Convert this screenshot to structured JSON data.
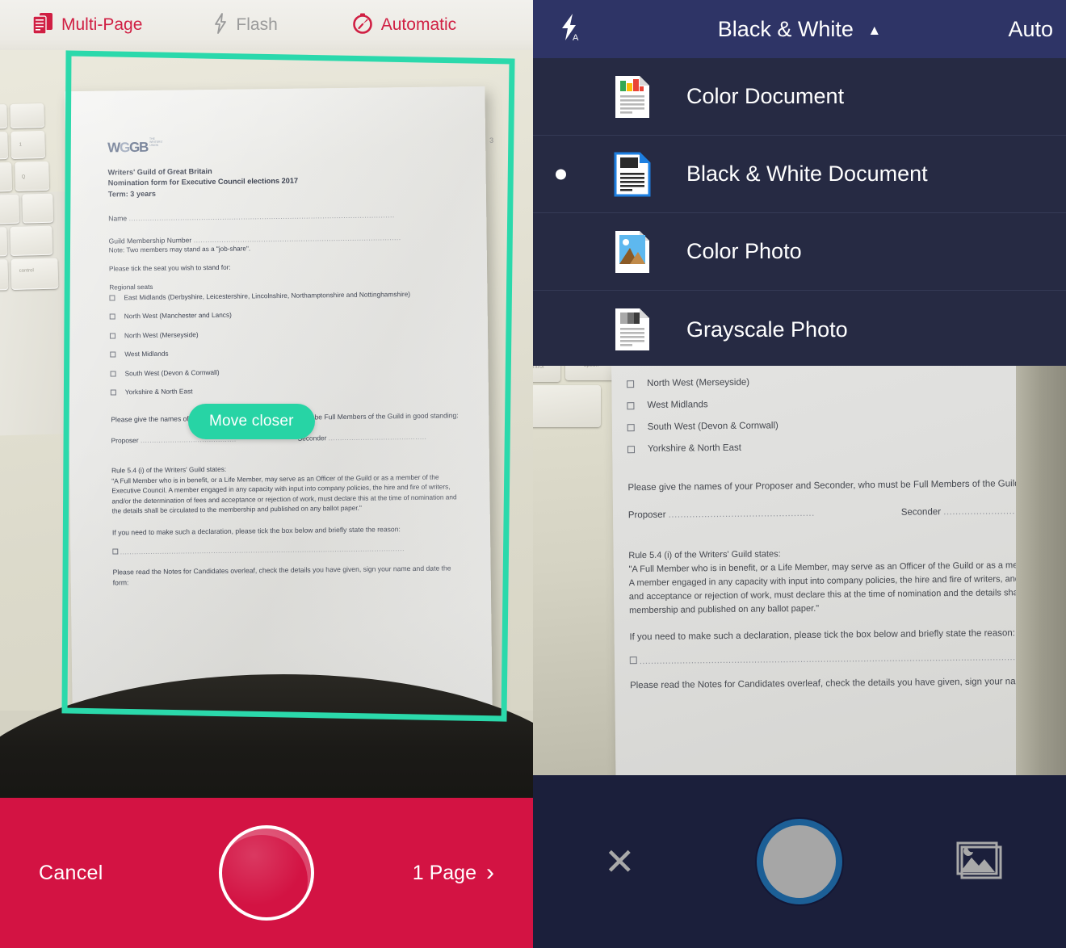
{
  "left_panel": {
    "top_bar": {
      "multipage_label": "Multi-Page",
      "multipage_icon": "multi-page-icon",
      "flash_label": "Flash",
      "flash_icon": "flash-bolt-icon",
      "automatic_label": "Automatic",
      "automatic_icon": "timer-automatic-icon",
      "accent_color": "#d01f43",
      "inactive_color": "#9a9a9a",
      "background_color": "#eeece6"
    },
    "viewfinder": {
      "hint_badge": "Move closer",
      "hint_badge_color": "#27d4a5",
      "edge_frame_color": "#2bd9ab"
    },
    "document": {
      "logo_text": "WGGB",
      "logo_sub_lines": [
        "THE",
        "WRITERS'",
        "UNION"
      ],
      "page_number": "3",
      "title_lines": [
        "Writers' Guild of Great Britain",
        "Nomination form for Executive Council elections 2017",
        "Term: 3 years"
      ],
      "name_label": "Name",
      "membership_label": "Guild Membership Number",
      "membership_note": "Note: Two members may stand as a \"job-share\".",
      "tick_instruction": "Please tick the seat you wish to stand for:",
      "regional_heading": "Regional seats",
      "regional_seats": [
        "East Midlands (Derbyshire, Leicestershire, Lincolnshire, Northamptonshire and Nottinghamshire)",
        "North West (Manchester and Lancs)",
        "North West (Merseyside)",
        "West Midlands",
        "South West (Devon & Cornwall)",
        "Yorkshire & North East"
      ],
      "proposer_paragraph": "Please give the names of your Proposer and Seconder, who must be Full Members of the Guild in good standing:",
      "proposer_label": "Proposer",
      "seconder_label": "Seconder",
      "rule_heading": "Rule 5.4 (i) of the Writers' Guild states:",
      "rule_body": "\"A Full Member who is in benefit, or a Life Member, may serve as an Officer of the Guild or as a member of the Executive Council. A member engaged in any capacity with input into company policies, the hire and fire of writers, and/or the determination of fees and acceptance or rejection of work, must declare this at the time of nomination and the details shall be circulated to the membership and published on any ballot paper.\"",
      "declaration_line": "If you need to make such a declaration, please tick the box below and briefly state the reason:",
      "closing_paragraph": "Please read the Notes for Candidates overleaf, check the details you have given, sign your name and date the form:"
    },
    "bottom_bar": {
      "cancel_label": "Cancel",
      "page_count_label": "1 Page",
      "chevron_icon": "chevron-right-icon",
      "shutter_icon": "camera-shutter-icon",
      "background_color": "#d31343"
    }
  },
  "right_panel": {
    "top_bar": {
      "flash_icon": "flash-auto-icon",
      "mode_title": "Black & White",
      "caret_icon": "caret-up-icon",
      "auto_label": "Auto",
      "background_color": "#2e3466"
    },
    "dropdown": {
      "background_color": "#262a43",
      "items": [
        {
          "label": "Color Document",
          "icon": "color-document-icon",
          "selected": false
        },
        {
          "label": "Black & White Document",
          "icon": "bw-document-icon",
          "selected": true
        },
        {
          "label": "Color Photo",
          "icon": "color-photo-icon",
          "selected": false
        },
        {
          "label": "Grayscale Photo",
          "icon": "grayscale-photo-icon",
          "selected": false
        }
      ]
    },
    "preview_document": {
      "regional_seats": [
        "North West (Merseyside)",
        "West Midlands",
        "South West (Devon & Cornwall)",
        "Yorkshire & North East"
      ],
      "proposer_paragraph": "Please give the names of your Proposer and Seconder, who must be Full Members of the Guild in good standing:",
      "proposer_label": "Proposer",
      "seconder_label": "Seconder",
      "rule_heading": "Rule 5.4 (i) of the Writers' Guild states:",
      "rule_body": "\"A Full Member who is in benefit, or a Life Member, may serve as an Officer of the Guild or as a member of the Executive Council. A member engaged in any capacity with input into company policies, the hire and fire of writers, and/or the determination of fees and acceptance or rejection of work, must declare this at the time of nomination and the details shall be circulated to the membership and published on any ballot paper.\"",
      "declaration_line": "If you need to make such a declaration, please tick the box below and briefly state the reason:",
      "closing_paragraph": "Please read the Notes for Candidates overleaf, check the details you have given, sign your name and date the form:",
      "keyboard_keys": [
        "control",
        "option"
      ]
    },
    "bottom_bar": {
      "close_icon": "close-x-icon",
      "shutter_icon": "camera-shutter-icon",
      "gallery_icon": "gallery-image-icon",
      "background_color": "#1b1f3b",
      "shutter_ring_color": "#1c5f96"
    }
  }
}
